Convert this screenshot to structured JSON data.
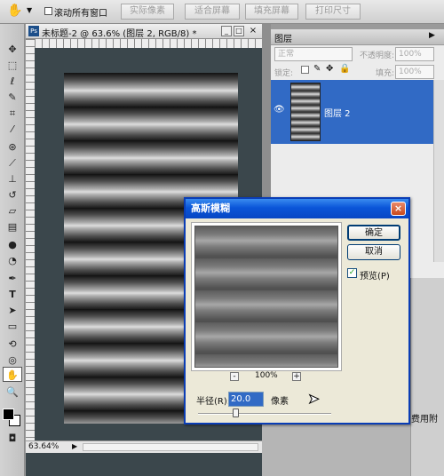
{
  "options_bar": {
    "scroll_all_label": "滚动所有窗口",
    "buttons": [
      "实际像素",
      "适合屏幕",
      "填充屏幕",
      "打印尺寸"
    ]
  },
  "document": {
    "title": "未标题-2 @ 63.6% (图层 2, RGB/8) *",
    "zoom": "63.64%"
  },
  "layers_panel": {
    "tab": "图层",
    "blend_mode": "正常",
    "opacity_label": "不透明度:",
    "opacity_value": "100%",
    "lock_label": "锁定:",
    "fill_label": "填充:",
    "fill_value": "100%",
    "layer_name": "图层 2"
  },
  "lower_panel_text": "费用附",
  "dialog": {
    "title": "高斯模糊",
    "ok_label": "确定",
    "cancel_label": "取消",
    "preview_label": "预览(P)",
    "preview_checked": true,
    "zoom_minus": "-",
    "zoom_value": "100%",
    "zoom_plus": "+",
    "radius_label": "半径(R):",
    "radius_value": "20.0",
    "radius_unit": "像素",
    "slider_fraction": 0.28
  },
  "colors": {
    "dialog_title_bar": "#0a55d8",
    "selection_blue": "#316ac5",
    "document_bg": "#3b474c"
  }
}
